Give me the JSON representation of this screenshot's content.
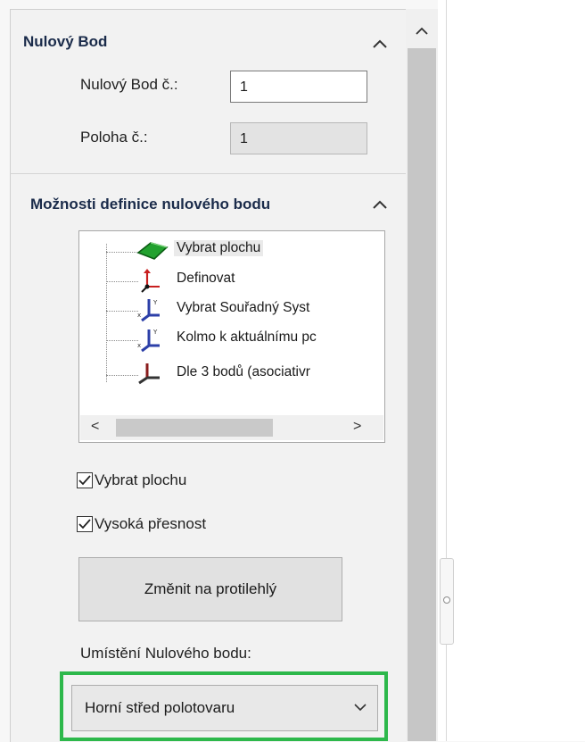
{
  "panel": {
    "section1": {
      "title": "Nulový Bod",
      "zero_point_label": "Nulový Bod č.:",
      "zero_point_value": "1",
      "position_label": "Poloha č.:",
      "position_value": "1"
    },
    "section2": {
      "title": "Možnosti definice nulového bodu",
      "tree_items": [
        {
          "label": "Vybrat plochu",
          "icon": "green-face-icon"
        },
        {
          "label": "Definovat",
          "icon": "define-axes-icon"
        },
        {
          "label": "Vybrat Souřadný Syst",
          "icon": "coordinate-system-icon"
        },
        {
          "label": "Kolmo k aktuálnímu pc",
          "icon": "perpendicular-axes-icon"
        },
        {
          "label": "Dle 3 bodů (asociativr",
          "icon": "three-point-axes-icon"
        }
      ],
      "scroll_left": "<",
      "scroll_right": ">",
      "checkbox_select_face": "Vybrat plochu",
      "checkbox_high_precision": "Vysoká přesnost",
      "flip_button": "Změnit na protilehlý",
      "placement_label": "Umístění Nulového bodu:",
      "placement_value": "Horní střed polotovaru"
    }
  },
  "colors": {
    "highlight": "#2db84b",
    "title": "#1a2b4a"
  }
}
